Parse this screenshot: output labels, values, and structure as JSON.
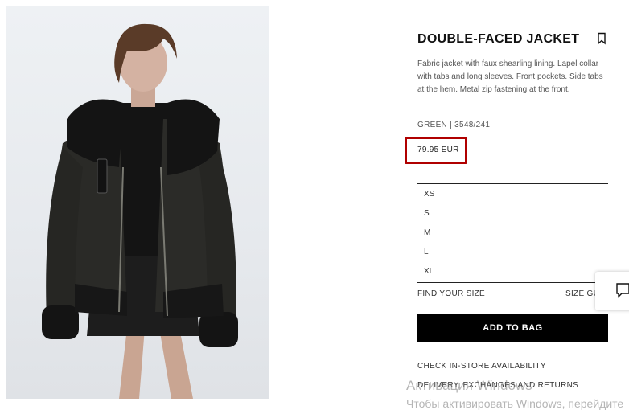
{
  "product": {
    "title": "DOUBLE-FACED JACKET",
    "description": "Fabric jacket with faux shearling lining. Lapel collar with tabs and long sleeves. Front pockets. Side tabs at the hem. Metal zip fastening at the front.",
    "reference": "GREEN | 3548/241",
    "price": "79.95 EUR",
    "highlight_color": "#b00000"
  },
  "sizes": [
    "XS",
    "S",
    "M",
    "L",
    "XL"
  ],
  "size_links": {
    "find_your_size": "FIND YOUR SIZE",
    "size_guide": "SIZE GU"
  },
  "actions": {
    "add_to_bag": "ADD TO BAG",
    "check_store": "CHECK IN-STORE AVAILABILITY",
    "delivery": "DELIVERY, EXCHANGES AND RETURNS"
  },
  "icons": {
    "bookmark": "bookmark-icon",
    "chat": "chat-icon"
  },
  "watermark": {
    "line1": "Активация Windows",
    "line2": "Чтобы активировать Windows, перейдите"
  }
}
